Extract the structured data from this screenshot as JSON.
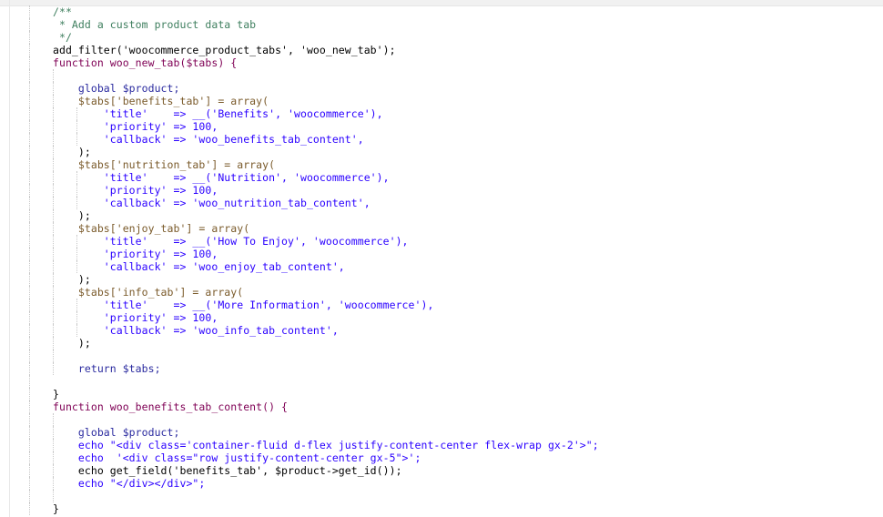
{
  "editor": {
    "lines": [
      "/**",
      " * Add a custom product data tab",
      " */",
      "add_filter('woocommerce_product_tabs', 'woo_new_tab');",
      "function woo_new_tab($tabs) {",
      "",
      "    global $product;",
      "    $tabs['benefits_tab'] = array(",
      "        'title'    => __('Benefits', 'woocommerce'),",
      "        'priority' => 100,",
      "        'callback' => 'woo_benefits_tab_content',",
      "    );",
      "    $tabs['nutrition_tab'] = array(",
      "        'title'    => __('Nutrition', 'woocommerce'),",
      "        'priority' => 100,",
      "        'callback' => 'woo_nutrition_tab_content',",
      "    );",
      "    $tabs['enjoy_tab'] = array(",
      "        'title'    => __('How To Enjoy', 'woocommerce'),",
      "        'priority' => 100,",
      "        'callback' => 'woo_enjoy_tab_content',",
      "    );",
      "    $tabs['info_tab'] = array(",
      "        'title'    => __('More Information', 'woocommerce'),",
      "        'priority' => 100,",
      "        'callback' => 'woo_info_tab_content',",
      "    );",
      "",
      "    return $tabs;",
      "",
      "}",
      "function woo_benefits_tab_content() {",
      "",
      "    global $product;",
      "    echo \"<div class='container-fluid d-flex justify-content-center flex-wrap gx-2'>\";",
      "    echo  '<div class=\"row justify-content-center gx-5\">';",
      "    echo get_field('benefits_tab', $product->get_id());",
      "    echo \"</div></div>\";",
      "",
      "}"
    ]
  }
}
